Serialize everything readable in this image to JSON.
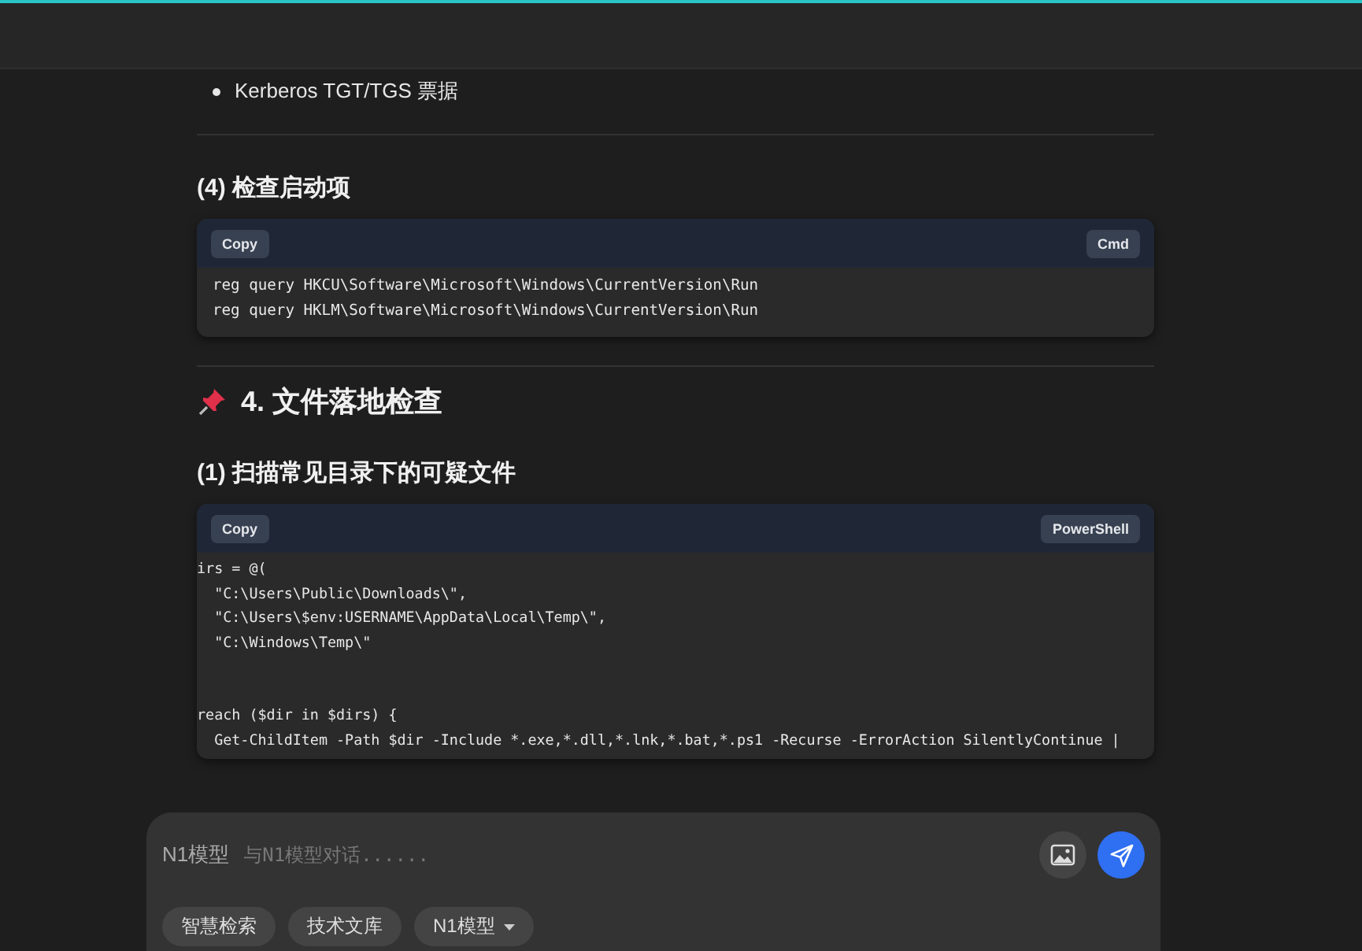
{
  "bullets": [
    "Kerberos TGT/TGS 票据"
  ],
  "sections": [
    {
      "kind": "h3",
      "title": "(4) 检查启动项"
    },
    {
      "kind": "code",
      "copy": "Copy",
      "language": "Cmd",
      "paragraphs": [
        [
          "reg query HKCU\\Software\\Microsoft\\Windows\\CurrentVersion\\Run",
          "reg query HKLM\\Software\\Microsoft\\Windows\\CurrentVersion\\Run"
        ]
      ],
      "clipped": false
    },
    {
      "kind": "rule"
    },
    {
      "kind": "h2",
      "title": "4. 文件落地检查"
    },
    {
      "kind": "h3",
      "title": "(1) 扫描常见目录下的可疑文件"
    },
    {
      "kind": "code",
      "copy": "Copy",
      "language": "PowerShell",
      "paragraphs": [
        [
          "irs = @(",
          "  \"C:\\Users\\Public\\Downloads\\\",",
          "  \"C:\\Users\\$env:USERNAME\\AppData\\Local\\Temp\\\",",
          "  \"C:\\Windows\\Temp\\\""
        ],
        [
          "reach ($dir in $dirs) {",
          "  Get-ChildItem -Path $dir -Include *.exe,*.dll,*.lnk,*.bat,*.ps1 -Recurse -ErrorAction SilentlyContinue |"
        ]
      ],
      "clipped": true
    }
  ],
  "composer": {
    "model": "N1模型",
    "placeholder": "与N1模型对话......",
    "chips": [
      {
        "label": "智慧检索",
        "kind": "toggle"
      },
      {
        "label": "技术文库",
        "kind": "toggle"
      },
      {
        "label": "N1模型",
        "kind": "dropdown"
      }
    ]
  }
}
